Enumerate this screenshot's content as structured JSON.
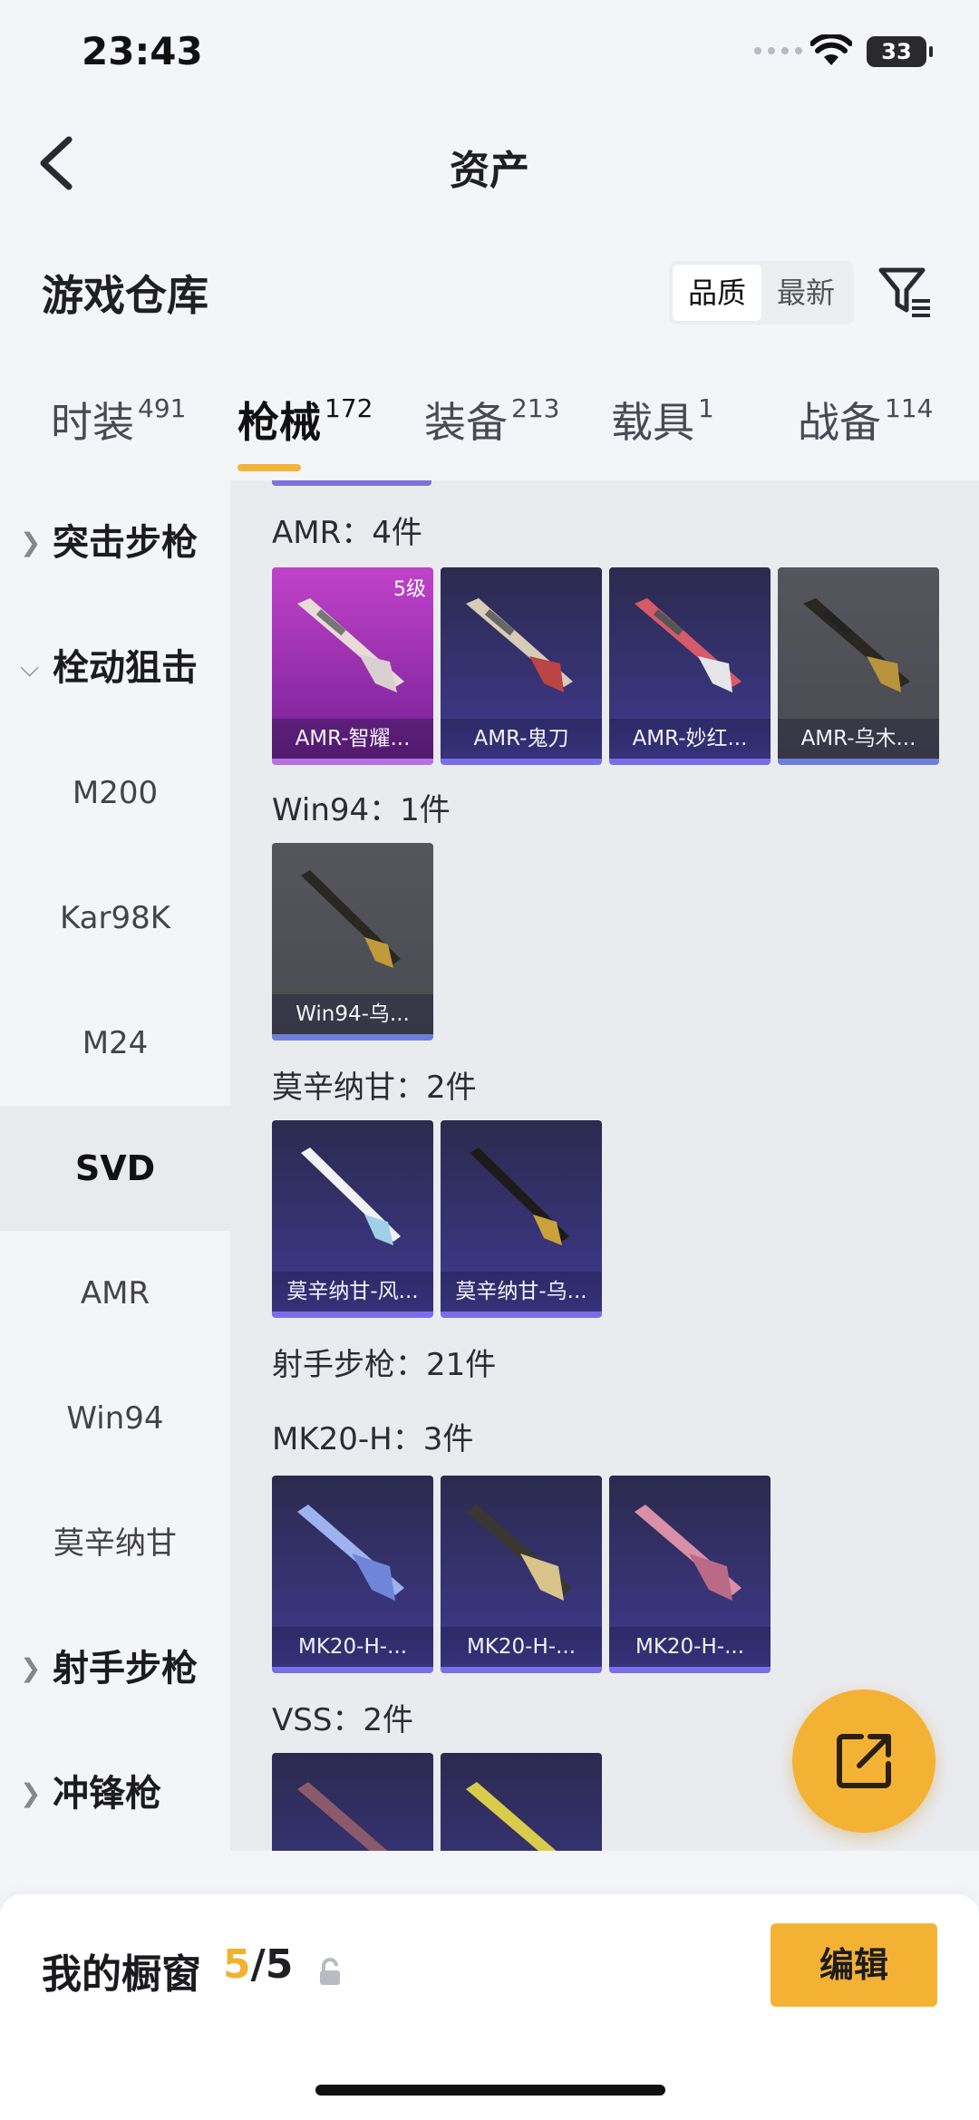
{
  "status": {
    "time": "23:43",
    "battery": "33"
  },
  "nav": {
    "title": "资产"
  },
  "warehouse": {
    "title": "游戏仓库",
    "sort_options": [
      "品质",
      "最新"
    ],
    "active_sort": "品质"
  },
  "tabs": [
    {
      "label": "时装",
      "count": "491"
    },
    {
      "label": "枪械",
      "count": "172"
    },
    {
      "label": "装备",
      "count": "213"
    },
    {
      "label": "载具",
      "count": "1"
    },
    {
      "label": "战备",
      "count": "114"
    }
  ],
  "active_tab": "枪械",
  "sidebar": {
    "items": [
      {
        "label": "突击步枪",
        "type": "group",
        "expanded": false
      },
      {
        "label": "栓动狙击",
        "type": "group",
        "expanded": true
      },
      {
        "label": "M200",
        "type": "sub"
      },
      {
        "label": "Kar98K",
        "type": "sub"
      },
      {
        "label": "M24",
        "type": "sub"
      },
      {
        "label": "SVD",
        "type": "sub",
        "active": true
      },
      {
        "label": "AMR",
        "type": "sub"
      },
      {
        "label": "Win94",
        "type": "sub"
      },
      {
        "label": "莫辛纳甘",
        "type": "sub"
      },
      {
        "label": "射手步枪",
        "type": "group",
        "expanded": false
      },
      {
        "label": "冲锋枪",
        "type": "group",
        "expanded": false
      }
    ]
  },
  "sections": [
    {
      "title": "AMR：4件",
      "items": [
        {
          "name": "AMR-智耀...",
          "rarity": "pink",
          "level": "5级"
        },
        {
          "name": "AMR-鬼刀",
          "rarity": "purple"
        },
        {
          "name": "AMR-妙红...",
          "rarity": "purple"
        },
        {
          "name": "AMR-乌木...",
          "rarity": "grey"
        }
      ]
    },
    {
      "title": "Win94：1件",
      "items": [
        {
          "name": "Win94-乌...",
          "rarity": "grey"
        }
      ]
    },
    {
      "title": "莫辛纳甘：2件",
      "items": [
        {
          "name": "莫辛纳甘-风...",
          "rarity": "purple"
        },
        {
          "name": "莫辛纳甘-乌...",
          "rarity": "purple"
        }
      ]
    },
    {
      "title": "射手步枪：21件",
      "items": []
    },
    {
      "title": "MK20-H：3件",
      "items": [
        {
          "name": "MK20-H-...",
          "rarity": "purple"
        },
        {
          "name": "MK20-H-...",
          "rarity": "purple"
        },
        {
          "name": "MK20-H-...",
          "rarity": "purple"
        }
      ]
    },
    {
      "title": "VSS：2件",
      "items": [
        {
          "name": "",
          "rarity": "purple"
        },
        {
          "name": "",
          "rarity": "purple"
        }
      ]
    }
  ],
  "showcase": {
    "label": "我的橱窗",
    "current": "5",
    "total": "/5",
    "edit_label": "编辑"
  },
  "colors": {
    "accent": "#f4b235",
    "purple_rarity": "#7a6ee8",
    "pink_rarity": "#c142c9",
    "grey_rarity": "#55565c"
  }
}
